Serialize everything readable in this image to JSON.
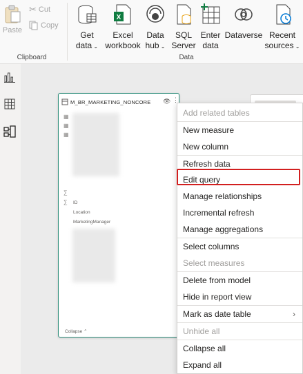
{
  "ribbon": {
    "clipboard": {
      "paste_label": "Paste",
      "cut_label": "Cut",
      "copy_label": "Copy",
      "group_label": "Clipboard"
    },
    "data": {
      "group_label": "Data",
      "buttons": [
        {
          "line1": "Get",
          "line2": "data",
          "dropdown": true,
          "icon": "get-data-icon"
        },
        {
          "line1": "Excel",
          "line2": "workbook",
          "dropdown": false,
          "icon": "excel-icon"
        },
        {
          "line1": "Data",
          "line2": "hub",
          "dropdown": true,
          "icon": "data-hub-icon"
        },
        {
          "line1": "SQL",
          "line2": "Server",
          "dropdown": false,
          "icon": "sql-server-icon"
        },
        {
          "line1": "Enter",
          "line2": "data",
          "dropdown": false,
          "icon": "enter-data-icon"
        },
        {
          "line1": "Dataverse",
          "line2": "",
          "dropdown": false,
          "icon": "dataverse-icon"
        },
        {
          "line1": "Recent",
          "line2": "sources",
          "dropdown": true,
          "icon": "recent-sources-icon"
        }
      ]
    }
  },
  "rail": {
    "icons": [
      "report-view-icon",
      "table-view-icon",
      "model-view-icon"
    ]
  },
  "table_card": {
    "title": "M_BR_MARKETING_NONCORE",
    "fields": [
      "ID",
      "Location",
      "MarketingManager"
    ],
    "collapse_label": "Collapse"
  },
  "context_menu": {
    "items": [
      {
        "label": "Add related tables",
        "disabled": true
      },
      {
        "label": "New measure",
        "disabled": false
      },
      {
        "label": "New column",
        "disabled": false
      },
      {
        "label": "Refresh data",
        "disabled": false
      },
      {
        "label": "Edit query",
        "disabled": false,
        "highlighted": true
      },
      {
        "label": "Manage relationships",
        "disabled": false
      },
      {
        "label": "Incremental refresh",
        "disabled": false
      },
      {
        "label": "Manage aggregations",
        "disabled": false
      },
      {
        "label": "Select columns",
        "disabled": false
      },
      {
        "label": "Select measures",
        "disabled": true
      },
      {
        "label": "Delete from model",
        "disabled": false
      },
      {
        "label": "Hide in report view",
        "disabled": false
      },
      {
        "label": "Mark as date table",
        "disabled": false,
        "submenu": true
      },
      {
        "label": "Unhide all",
        "disabled": true
      },
      {
        "label": "Collapse all",
        "disabled": false
      },
      {
        "label": "Expand all",
        "disabled": false
      }
    ]
  },
  "colors": {
    "accent": "#2c8c79",
    "highlight": "#d21f1f",
    "excel": "#107c41",
    "disabled": "#a19f9d"
  }
}
